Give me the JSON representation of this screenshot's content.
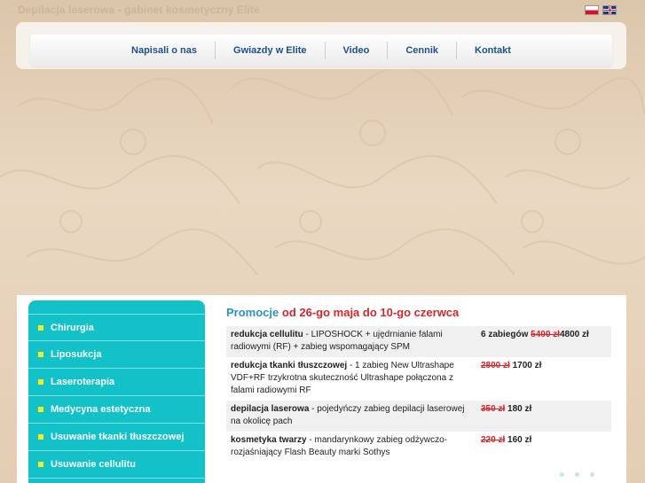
{
  "site": {
    "title": "Depilacja laserowa - gabinet kosmetyczny Elite",
    "languages": [
      "pl-flag-icon",
      "en-flag-icon"
    ]
  },
  "nav": {
    "items": [
      "Napisali o nas",
      "Gwiazdy w Elite",
      "Video",
      "Cennik",
      "Kontakt"
    ]
  },
  "sidebar": {
    "items": [
      "Chirurgia",
      "Liposukcja",
      "Laseroterapia",
      "Medycyna estetyczna",
      "Usuwanie tkanki tłuszczowej",
      "Usuwanie cellulitu"
    ]
  },
  "promo": {
    "title_prefix": "Promocje",
    "title_dates": "od 26-go maja do 10-go czerwca",
    "rows": [
      {
        "name": "redukcja cellulitu",
        "desc": " - LIPOSHOCK + ujędrnianie falami radiowymi (RF) + zabieg wspomagający SPM",
        "qty": "6 zabiegów",
        "old_price": "5400 zł",
        "new_price": "4800 zł"
      },
      {
        "name": "redukcja tkanki tłuszczowej",
        "desc": " - 1 zabieg New Ultrashape VDF+RF trzykrotna skuteczność Ultrashape połączona z falami radiowymi RF",
        "qty": "",
        "old_price": "2800 zł",
        "new_price": "1700 zł"
      },
      {
        "name": "depilacja laserowa",
        "desc": " - pojedyńczy zabieg depilacji laserowej na okolicę pach",
        "qty": "",
        "old_price": "350 zł",
        "new_price": "180 zł"
      },
      {
        "name": "kosmetyka twarzy",
        "desc": " - mandarynkowy zabieg odżywczo-rozjaśniający Flash Beauty marki Sothys",
        "qty": "",
        "old_price": "220 zł",
        "new_price": "160 zł"
      }
    ]
  },
  "colors": {
    "sidebar_bg": "#13c2c9",
    "bullet": "#f7ec18",
    "nav_text": "#1d4f8e",
    "promo_blue": "#2a94c4",
    "promo_red": "#d5262b"
  }
}
